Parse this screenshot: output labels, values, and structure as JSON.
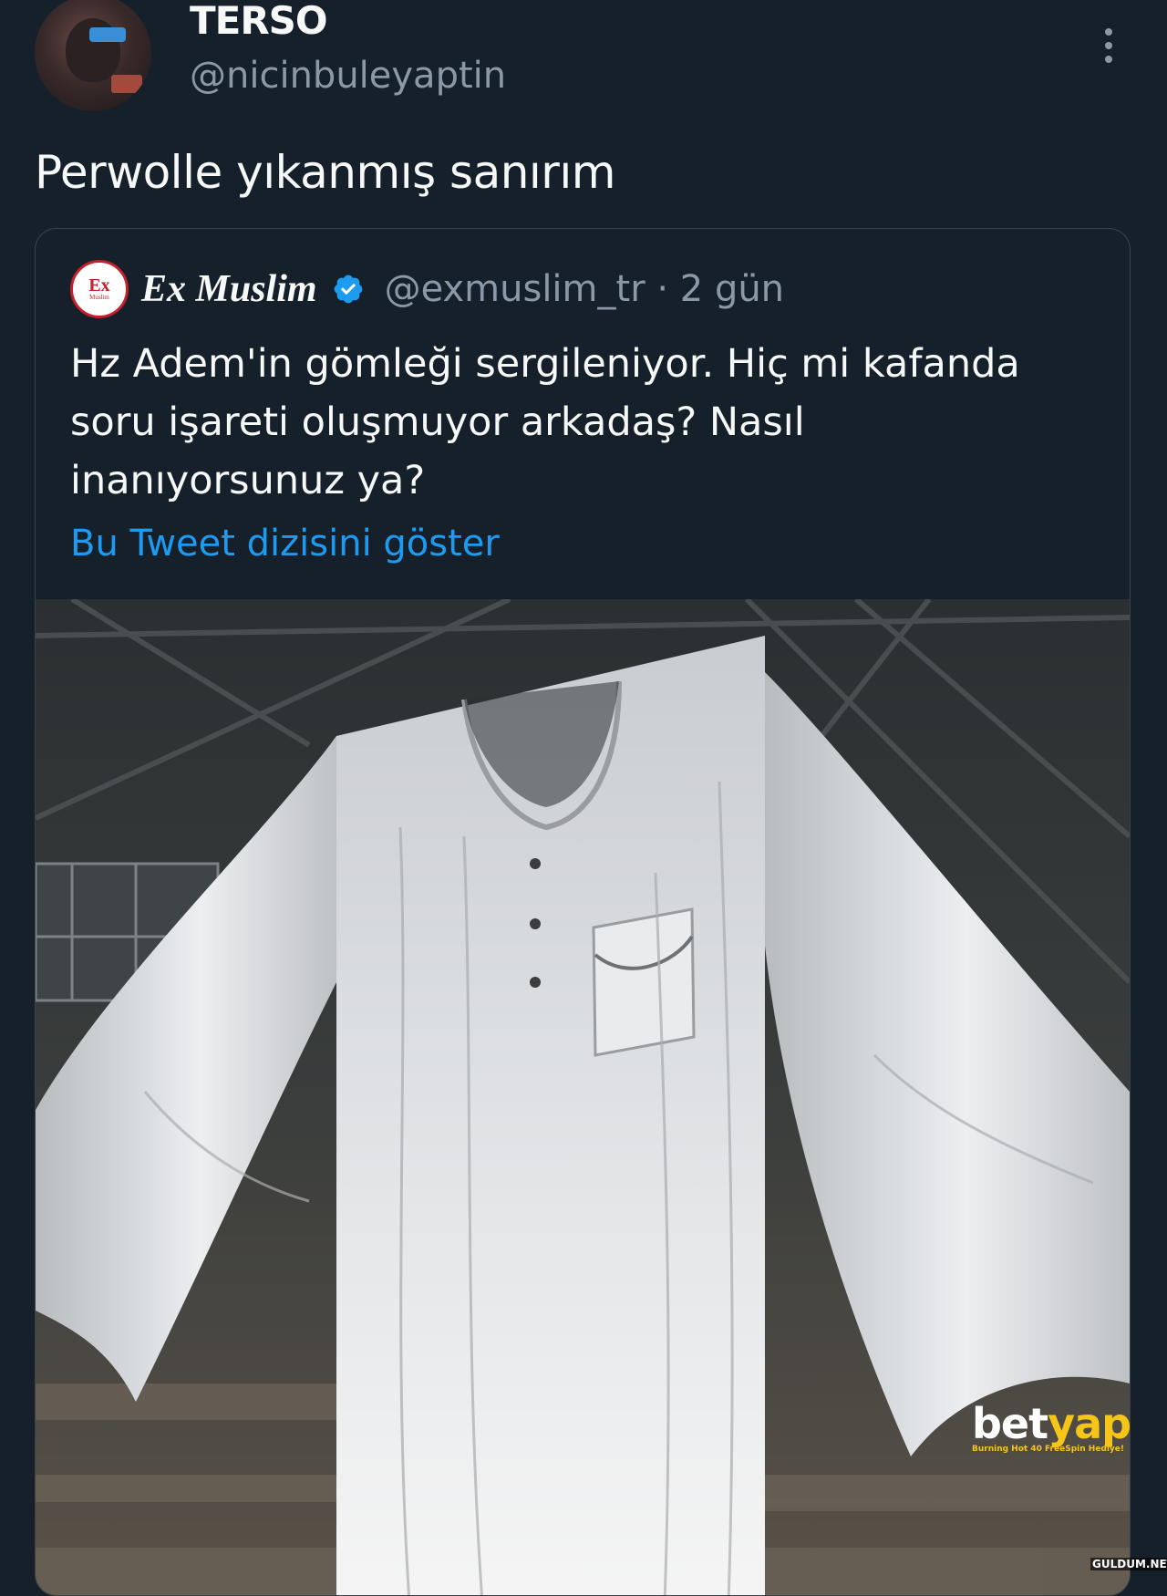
{
  "tweet": {
    "author": {
      "display_name": "TERSO",
      "handle": "@nicinbuleyaptin"
    },
    "text": "Perwolle yıkanmış sanırım",
    "more_icon": "more-vertical-icon"
  },
  "quoted_tweet": {
    "author": {
      "display_name": "Ex Muslim",
      "handle": "@exmuslim_tr · 2 gün",
      "avatar_text": "Ex",
      "avatar_subtext": "Muslim",
      "verified_icon": "verified-badge-icon"
    },
    "text_lines": [
      "Hz Adem'in gömleği sergileniyor. Hiç mi kafanda",
      "soru işareti oluşmuyor arkadaş? Nasıl",
      "inanıyorsunuz ya?"
    ],
    "show_thread_label": "Bu Tweet dizisini göster",
    "media": "giant white shirt hanging from a mall ceiling"
  },
  "watermark": {
    "brand_a": "bet",
    "brand_b": "yap",
    "promo": "Burning Hot 40 FreeSpin Hediye!",
    "site": "GULDUM.NET"
  },
  "colors": {
    "background": "#15202b",
    "text": "#f7f9f9",
    "muted": "#8b98a5",
    "link": "#1d9bf0",
    "border": "#38444d"
  }
}
